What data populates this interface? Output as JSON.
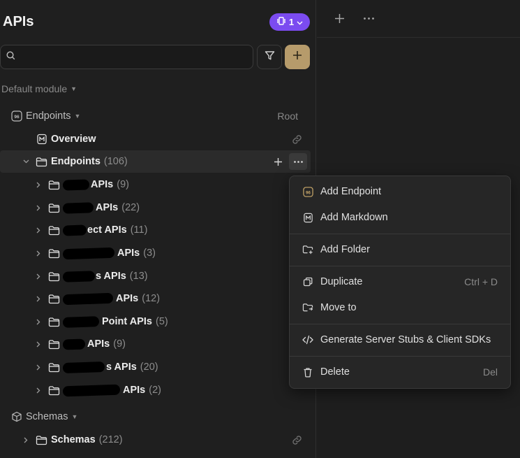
{
  "sidebar": {
    "title": "APIs",
    "badge": {
      "count": "1"
    },
    "search": {
      "placeholder": ""
    },
    "module": {
      "label": "Default module"
    },
    "endpoints_section": {
      "label": "Endpoints",
      "right": "Root"
    },
    "overview": {
      "label": "Overview"
    },
    "endpoints_folder": {
      "label": "Endpoints",
      "count": "(106)"
    },
    "folders": [
      {
        "label": "APIs",
        "count": "(9)"
      },
      {
        "label": "APIs",
        "count": "(22)"
      },
      {
        "label": "ect APIs",
        "count": "(11)"
      },
      {
        "label": "APIs",
        "count": "(3)"
      },
      {
        "label": "s APIs",
        "count": "(13)"
      },
      {
        "label": "APIs",
        "count": "(12)"
      },
      {
        "label": "Point APIs",
        "count": "(5)"
      },
      {
        "label": "APIs",
        "count": "(9)"
      },
      {
        "label": "s APIs",
        "count": "(20)"
      },
      {
        "label": "APIs",
        "count": "(2)"
      }
    ],
    "schemas_section": {
      "label": "Schemas"
    },
    "schemas_folder": {
      "label": "Schemas",
      "count": "(212)"
    }
  },
  "context_menu": {
    "items": [
      {
        "label": "Add Endpoint",
        "shortcut": ""
      },
      {
        "label": "Add Markdown",
        "shortcut": ""
      },
      {
        "label": "Add Folder",
        "shortcut": ""
      },
      {
        "label": "Duplicate",
        "shortcut": "Ctrl + D"
      },
      {
        "label": "Move to",
        "shortcut": ""
      },
      {
        "label": "Generate Server Stubs & Client SDKs",
        "shortcut": ""
      },
      {
        "label": "Delete",
        "shortcut": "Del"
      }
    ]
  },
  "colors": {
    "accent_purple": "#7b4bf0",
    "accent_gold": "#b69b6b",
    "background": "#1e1e1e"
  }
}
